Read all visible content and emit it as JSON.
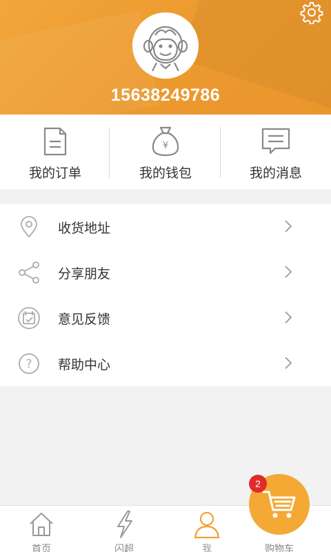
{
  "user": {
    "phone": "15638249786"
  },
  "quick_actions": [
    {
      "label": "我的订单",
      "icon": "document-icon"
    },
    {
      "label": "我的钱包",
      "icon": "money-bag-icon",
      "symbol": "¥"
    },
    {
      "label": "我的消息",
      "icon": "message-icon"
    }
  ],
  "menu": [
    {
      "label": "收货地址",
      "icon": "location-pin-icon"
    },
    {
      "label": "分享朋友",
      "icon": "share-icon"
    },
    {
      "label": "意见反馈",
      "icon": "feedback-icon"
    },
    {
      "label": "帮助中心",
      "icon": "help-icon",
      "symbol": "?"
    }
  ],
  "tabbar": [
    {
      "label": "首页",
      "icon": "home-icon"
    },
    {
      "label": "闪超",
      "icon": "lightning-icon"
    },
    {
      "label": "我",
      "icon": "person-icon",
      "active": true
    },
    {
      "label": "购物车",
      "icon": "cart-icon"
    }
  ],
  "cart": {
    "badge_count": "2"
  },
  "colors": {
    "accent": "#F0A035",
    "badge": "#E02B2B",
    "active_tab": "#F0A035"
  }
}
